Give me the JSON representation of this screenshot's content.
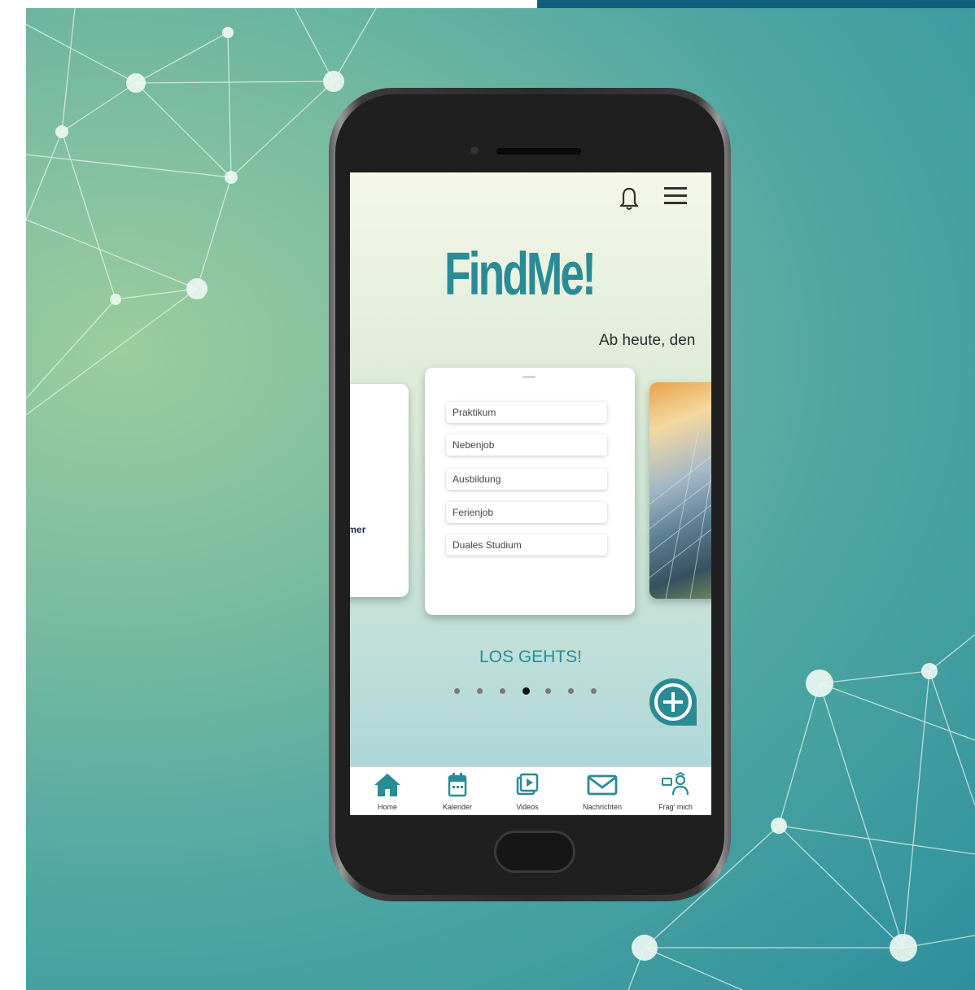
{
  "app": {
    "logo": "FindMe!",
    "date_line": "Ab heute, den",
    "header_icons": [
      "bell-icon",
      "menu-icon"
    ]
  },
  "carousel": {
    "left_card_text": "ammer",
    "center_card_options": [
      "Praktikum",
      "Nebenjob",
      "Ausbildung",
      "Ferienjob",
      "Duales Studium"
    ],
    "cta": "LOS GEHTS!",
    "page_count": 7,
    "active_page": 4
  },
  "tabbar": {
    "items": [
      {
        "label": "Home",
        "icon": "home-icon"
      },
      {
        "label": "Kalender",
        "icon": "calendar-icon"
      },
      {
        "label": "Videos",
        "icon": "video-icon"
      },
      {
        "label": "Nachrichten",
        "icon": "mail-icon"
      },
      {
        "label": "Frag' mich",
        "icon": "ask-icon"
      }
    ]
  },
  "colors": {
    "brand": "#2a8b95",
    "background_dark": "#2e8f9c",
    "background_light": "#9ccd9e",
    "top_band": "#0f5f7c"
  }
}
